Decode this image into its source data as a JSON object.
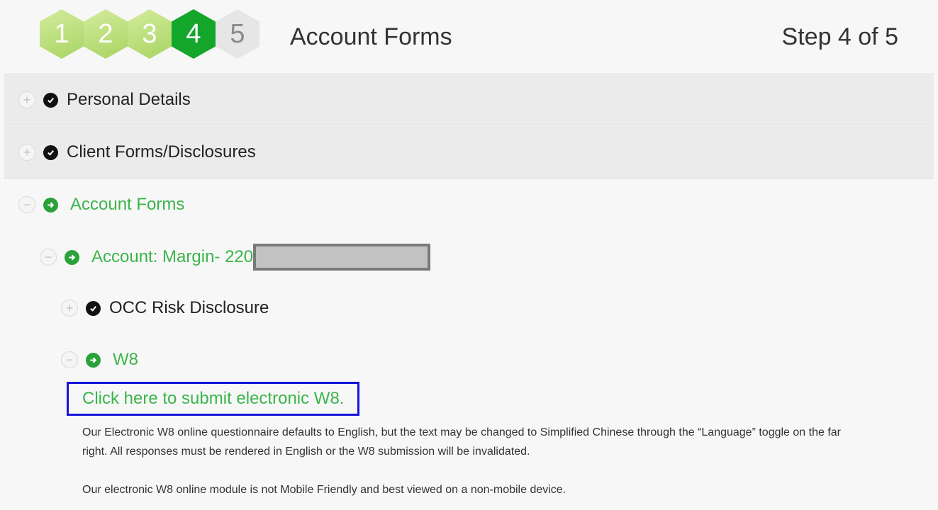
{
  "header": {
    "steps": [
      "1",
      "2",
      "3",
      "4",
      "5"
    ],
    "title": "Account Forms",
    "step_indicator": "Step 4 of 5"
  },
  "sections": {
    "personal_details": "Personal Details",
    "client_forms": "Client Forms/Disclosures",
    "account_forms": "Account Forms",
    "account_margin": "Account: Margin- 220",
    "occ_risk": "OCC Risk Disclosure",
    "w8": "W8"
  },
  "w8": {
    "submit_link": "Click here to submit electronic W8.",
    "paragraph1": "Our Electronic W8 online questionnaire defaults to English, but the text may be changed to Simplified Chinese through the “Language” toggle on the far right. All responses must be rendered in English or the W8 submission will be invalidated.",
    "paragraph2": "Our electronic W8 online module is not Mobile Friendly and best viewed on a non-mobile device."
  },
  "colors": {
    "active_green": "#14a52b",
    "completed_green": "#a9d463",
    "link_green": "#3ab54a",
    "focus_blue": "#1414d8"
  },
  "icons": {
    "plus": "+",
    "minus": "−"
  }
}
